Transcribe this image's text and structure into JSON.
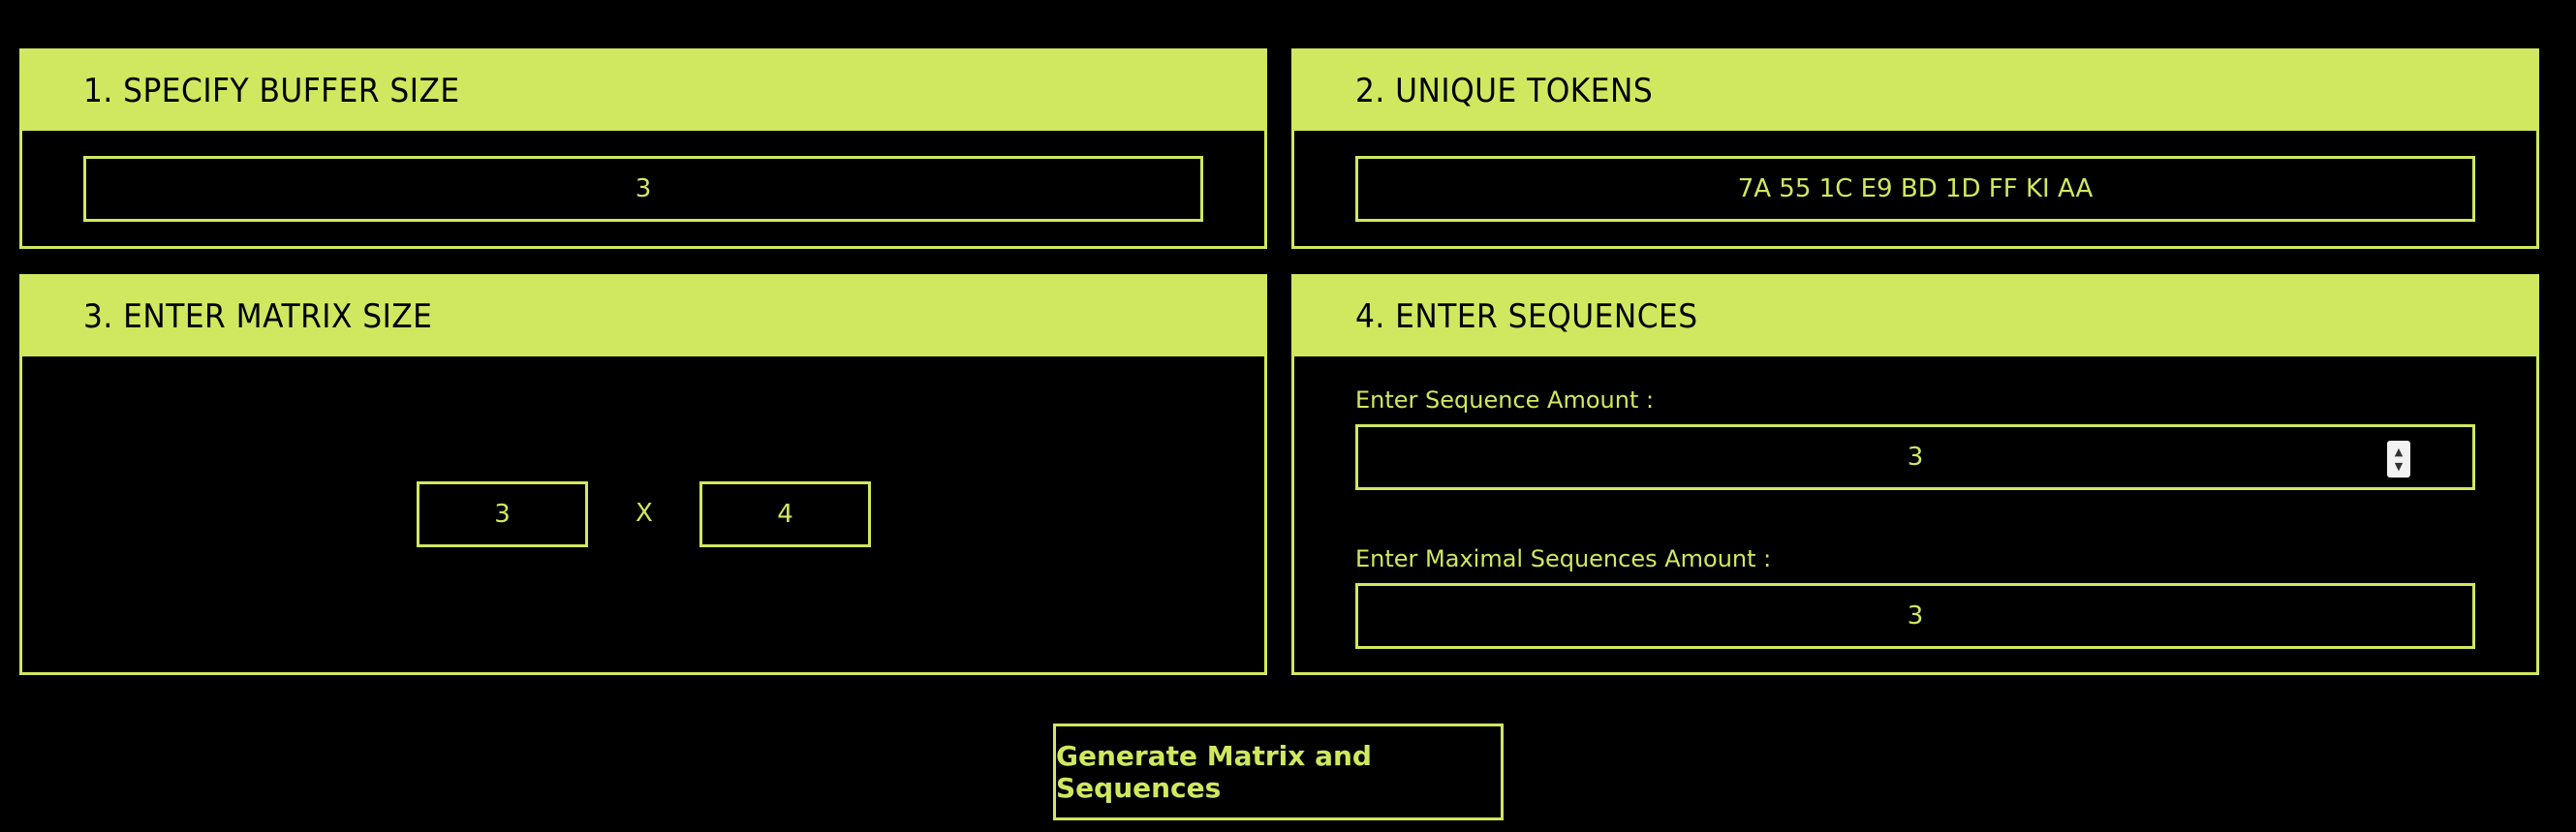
{
  "panels": {
    "buffer": {
      "title": "1. SPECIFY BUFFER SIZE",
      "value": "3"
    },
    "tokens": {
      "title": "2. UNIQUE TOKENS",
      "value": "7A 55 1C E9 BD 1D FF KI AA"
    },
    "matrix": {
      "title": "3. ENTER MATRIX SIZE",
      "rows": "3",
      "separator": "X",
      "cols": "4"
    },
    "sequences": {
      "title": "4. ENTER SEQUENCES",
      "amount_label": "Enter Sequence Amount :",
      "amount_value": "3",
      "max_label": "Enter Maximal Sequences Amount :",
      "max_value": "3"
    }
  },
  "actions": {
    "generate_label": "Generate Matrix and Sequences"
  },
  "icons": {
    "stepper": "number-stepper-icon"
  },
  "colors": {
    "accent": "#cfe85f",
    "background": "#000000",
    "header_text": "#000000"
  }
}
